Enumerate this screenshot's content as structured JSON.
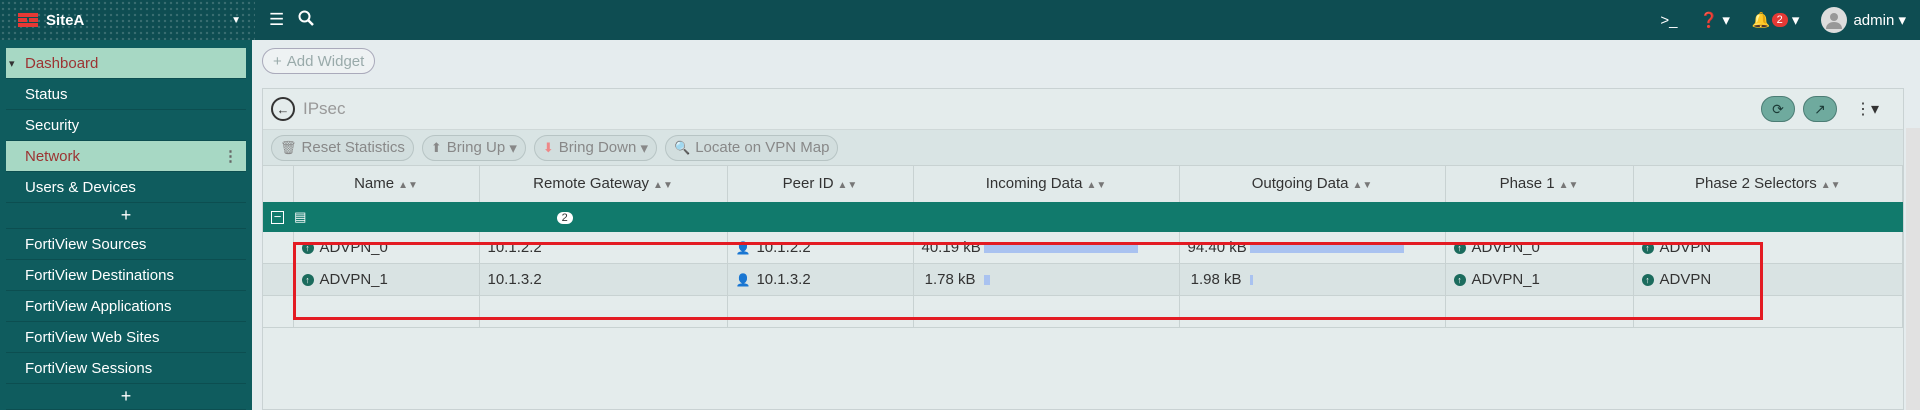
{
  "topbar": {
    "site_name": "SiteA",
    "user": "admin",
    "alert_count": "2",
    "terminal_icon": "terminal-icon",
    "help_icon": "help-icon",
    "bell_icon": "bell-icon"
  },
  "sidebar": {
    "section": "Dashboard",
    "items": [
      "Status",
      "Security",
      "Network",
      "Users & Devices"
    ],
    "fortiview_items": [
      "FortiView Sources",
      "FortiView Destinations",
      "FortiView Applications",
      "FortiView Web Sites",
      "FortiView Sessions"
    ],
    "plus": "+"
  },
  "main": {
    "add_widget": "Add Widget",
    "panel_title": "IPsec",
    "toolbar": {
      "reset": "Reset Statistics",
      "bring_up": "Bring Up",
      "bring_down": "Bring Down",
      "locate": "Locate on VPN Map"
    },
    "columns": [
      "Name",
      "Remote Gateway",
      "Peer ID",
      "Incoming Data",
      "Outgoing Data",
      "Phase 1",
      "Phase 2 Selectors"
    ],
    "group_count": "2",
    "rows": [
      {
        "name": "ADVPN_0",
        "gateway": "10.1.2.2",
        "peer": "10.1.2.2",
        "incoming": "40.19 kB",
        "incoming_frac": 1.0,
        "outgoing": "94.40 kB",
        "outgoing_frac": 1.0,
        "phase1": "ADVPN_0",
        "phase2": "ADVPN"
      },
      {
        "name": "ADVPN_1",
        "gateway": "10.1.3.2",
        "peer": "10.1.3.2",
        "incoming": "1.78 kB",
        "incoming_frac": 0.04,
        "outgoing": "1.98 kB",
        "outgoing_frac": 0.02,
        "phase1": "ADVPN_1",
        "phase2": "ADVPN"
      }
    ],
    "colors": {
      "accent": "#0e4d52",
      "group_row": "#117a6c",
      "highlight": "#e31b23",
      "bar": "#a9c2f0"
    }
  }
}
